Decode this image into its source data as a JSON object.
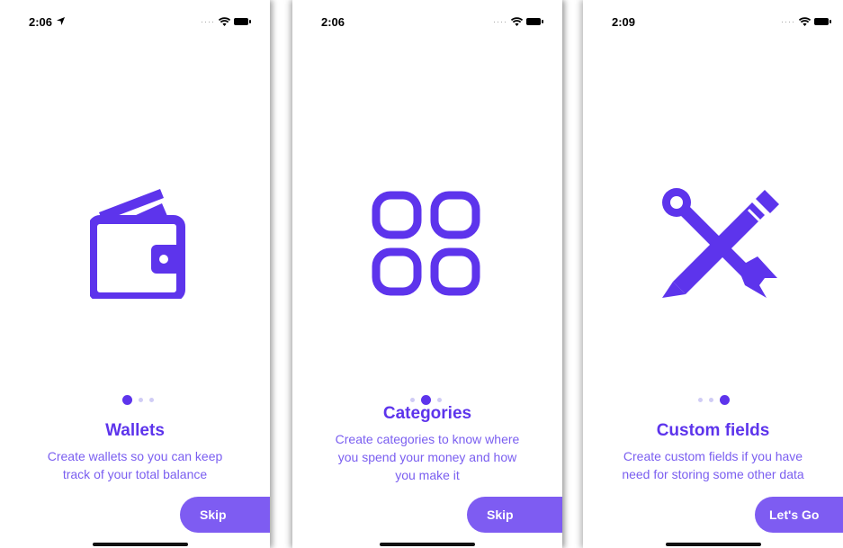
{
  "colors": {
    "accent": "#5d34ec",
    "button": "#7e5cf2",
    "dot_inactive": "#d0ccf5"
  },
  "screens": [
    {
      "status_time": "2:06",
      "icon": "wallet-icon",
      "page_index": 0,
      "title": "Wallets",
      "description_lines": [
        "Create wallets so you can keep",
        "track of your total balance"
      ],
      "button_label": "Skip"
    },
    {
      "status_time": "2:06",
      "icon": "categories-grid-icon",
      "page_index": 1,
      "title": "Categories",
      "description_lines": [
        "Create categories to know where",
        "you spend your money and how",
        "you make it"
      ],
      "button_label": "Skip"
    },
    {
      "status_time": "2:09",
      "icon": "tools-icon",
      "page_index": 2,
      "title": "Custom fields",
      "description_lines": [
        "Create custom fields if you have",
        "need for storing some other data"
      ],
      "button_label": "Let's Go"
    }
  ]
}
